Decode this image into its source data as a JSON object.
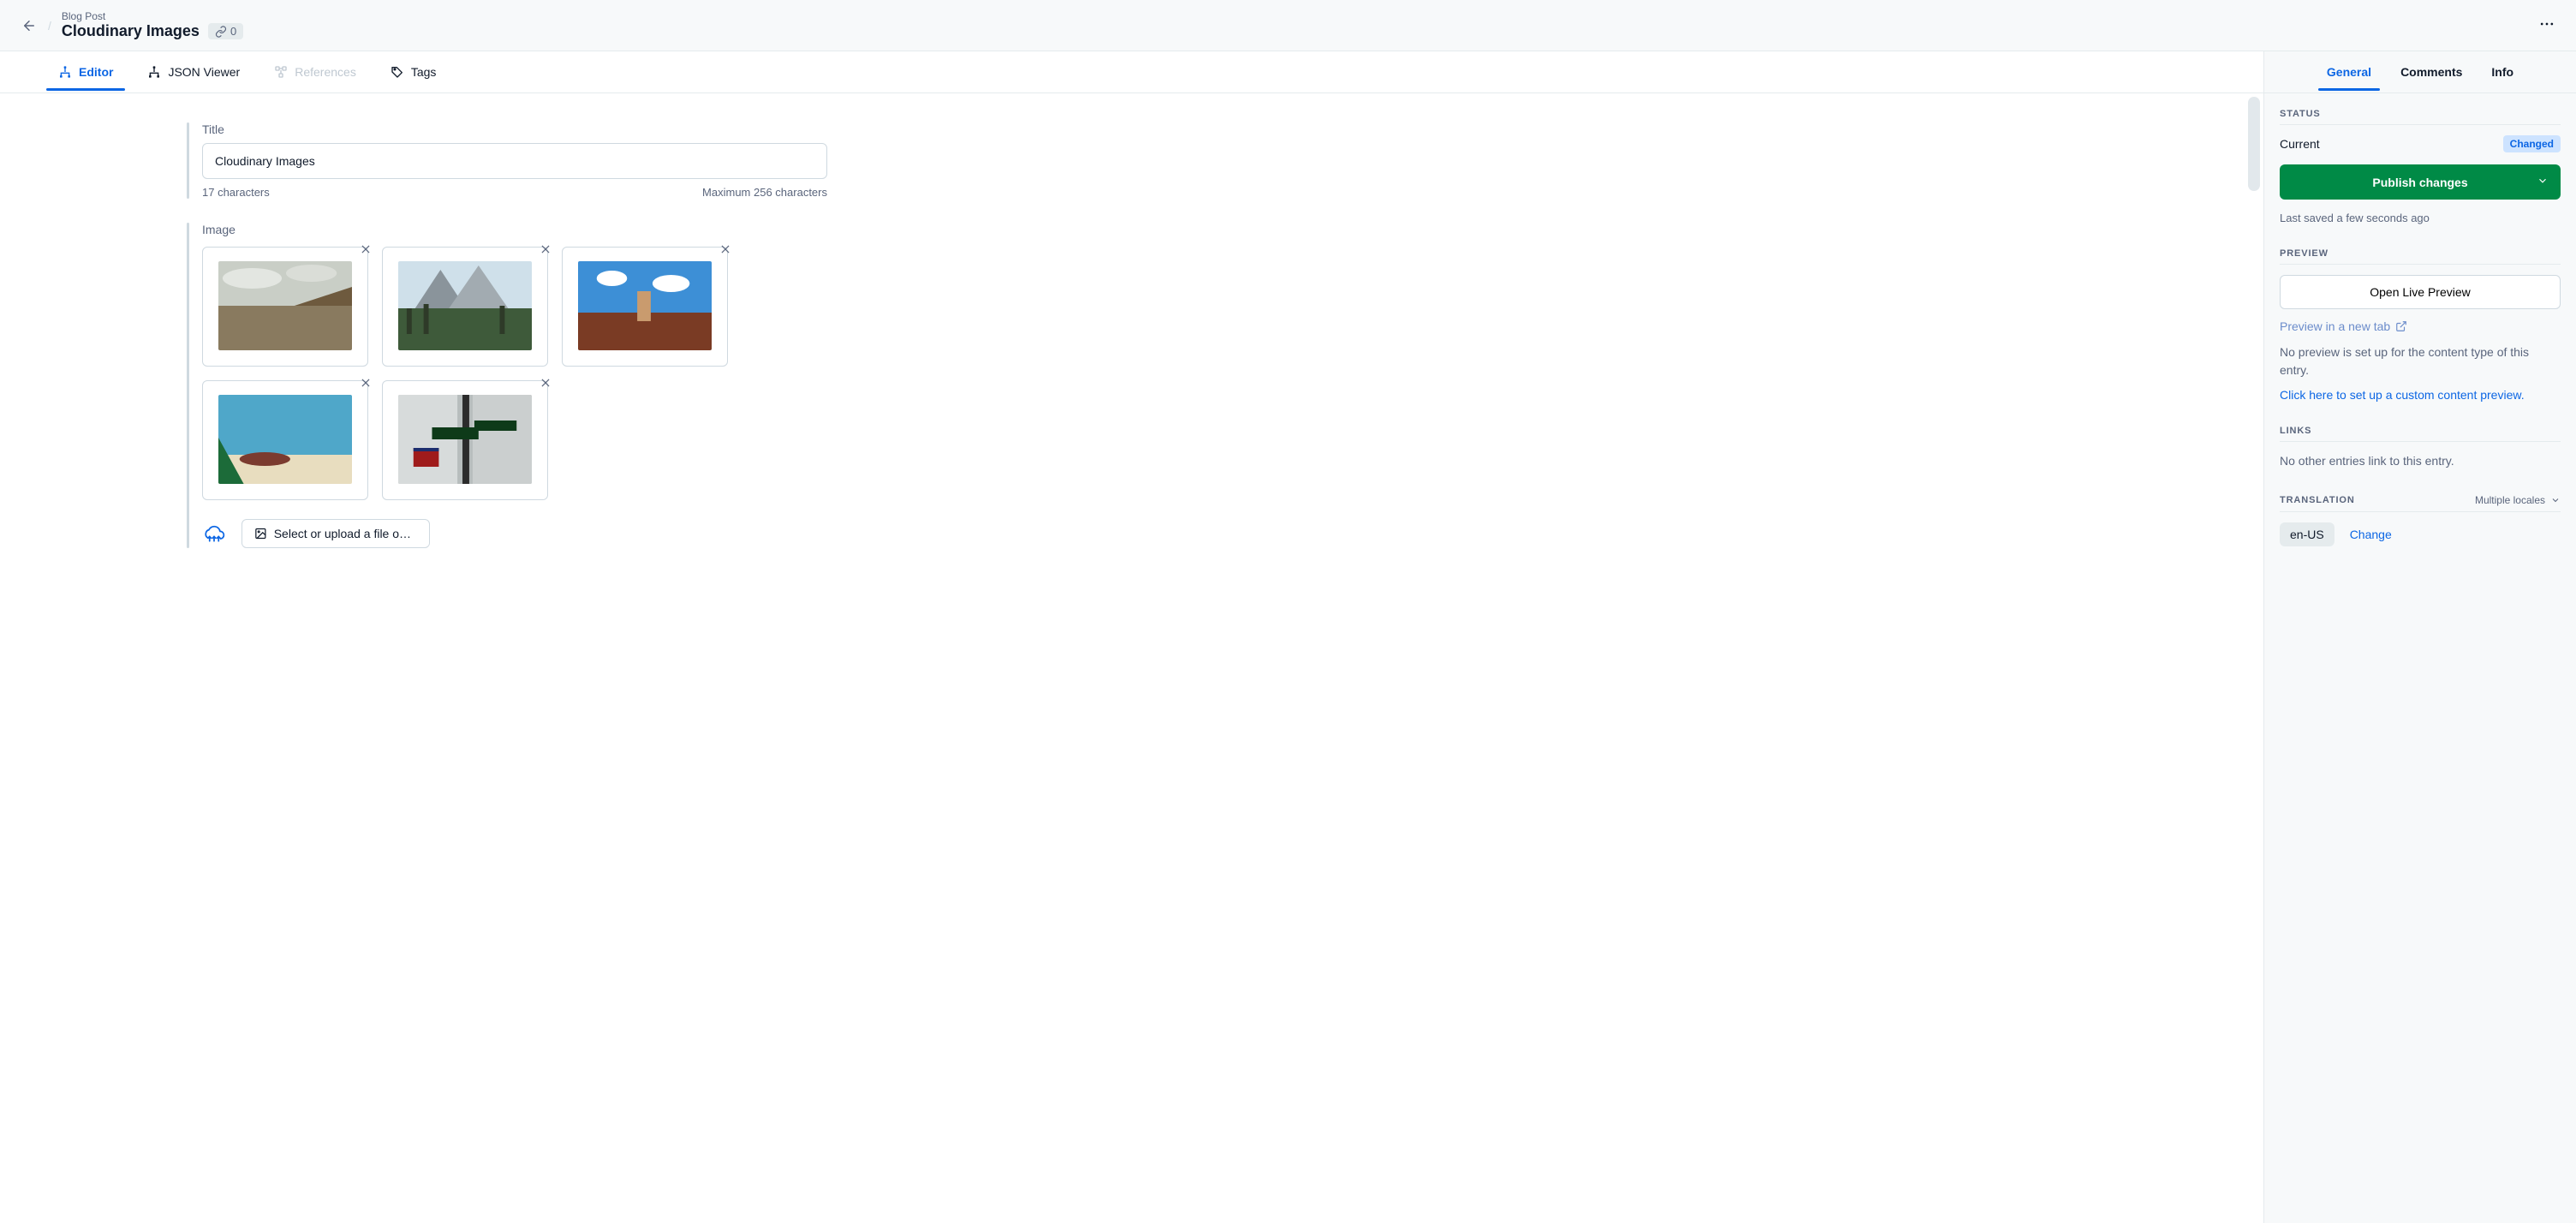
{
  "breadcrumb": {
    "content_type": "Blog Post",
    "title": "Cloudinary Images",
    "link_count": "0"
  },
  "left_tabs": [
    {
      "label": "Editor"
    },
    {
      "label": "JSON Viewer"
    },
    {
      "label": "References"
    },
    {
      "label": "Tags"
    }
  ],
  "title_field": {
    "label": "Title",
    "value": "Cloudinary Images",
    "char_count": "17 characters",
    "max_chars": "Maximum 256 characters"
  },
  "image_field": {
    "label": "Image",
    "upload_button": "Select or upload a file on C…"
  },
  "right_tabs": {
    "general": "General",
    "comments": "Comments",
    "info": "Info"
  },
  "status": {
    "heading": "STATUS",
    "current_label": "Current",
    "badge": "Changed",
    "publish_button": "Publish changes",
    "last_saved": "Last saved a few seconds ago"
  },
  "preview": {
    "heading": "PREVIEW",
    "open_live": "Open Live Preview",
    "new_tab": "Preview in a new tab",
    "no_preview": "No preview is set up for the content type of this entry.",
    "setup": "Click here to set up a custom content preview."
  },
  "links": {
    "heading": "LINKS",
    "empty": "No other entries link to this entry."
  },
  "translation": {
    "heading": "TRANSLATION",
    "multiple": "Multiple locales",
    "locale": "en-US",
    "change": "Change"
  }
}
